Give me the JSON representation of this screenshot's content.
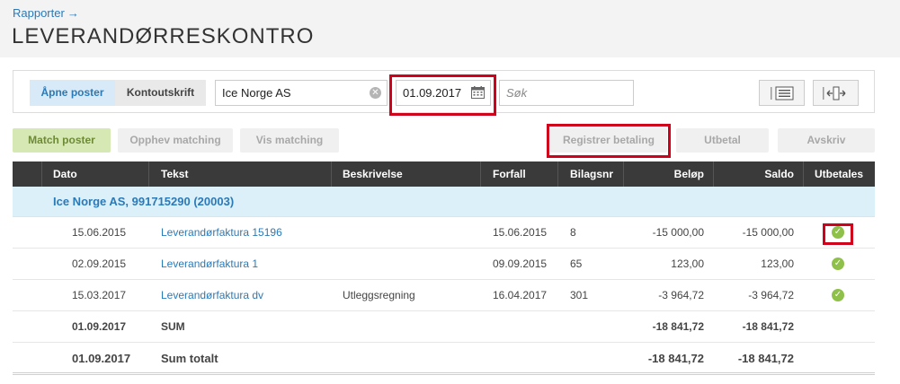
{
  "breadcrumb": {
    "label": "Rapporter",
    "arrow": "→"
  },
  "page_title": "LEVERANDØRRESKONTRO",
  "toolbar": {
    "tab_open": "Åpne poster",
    "tab_statement": "Kontoutskrift",
    "supplier_value": "Ice Norge AS",
    "date_value": "01.09.2017",
    "search_placeholder": "Søk"
  },
  "actions": {
    "match": "Match poster",
    "unmatch": "Opphev matching",
    "show_matching": "Vis matching",
    "register_payment": "Registrer betaling",
    "pay_out": "Utbetal",
    "write_off": "Avskriv"
  },
  "table": {
    "headers": [
      "Dato",
      "Tekst",
      "Beskrivelse",
      "Forfall",
      "Bilagsnr",
      "Beløp",
      "Saldo",
      "Utbetales"
    ],
    "group_label": "Ice Norge AS, 991715290 (20003)",
    "rows": [
      {
        "date": "15.06.2015",
        "text": "Leverandørfaktura 15196",
        "description": "",
        "due": "15.06.2015",
        "voucher": "8",
        "amount": "-15 000,00",
        "balance": "-15 000,00"
      },
      {
        "date": "02.09.2015",
        "text": "Leverandørfaktura 1",
        "description": "",
        "due": "09.09.2015",
        "voucher": "65",
        "amount": "123,00",
        "balance": "123,00"
      },
      {
        "date": "15.03.2017",
        "text": "Leverandørfaktura dv",
        "description": "Utleggsregning",
        "due": "16.04.2017",
        "voucher": "301",
        "amount": "-3 964,72",
        "balance": "-3 964,72"
      }
    ],
    "sum": {
      "date": "01.09.2017",
      "label": "SUM",
      "amount": "-18 841,72",
      "balance": "-18 841,72"
    },
    "total": {
      "date": "01.09.2017",
      "label": "Sum totalt",
      "amount": "-18 841,72",
      "balance": "-18 841,72"
    }
  },
  "icons": {
    "clear": "clear-icon",
    "calendar": "calendar-icon",
    "check": "check-icon",
    "view": "list-view-icon",
    "columns": "column-resize-icon"
  },
  "colors": {
    "accent": "#2a7ab8",
    "header_bg": "#3a3a3a",
    "group_bg": "#dcf0fa",
    "check": "#8fc04a",
    "highlight": "#d0021b"
  }
}
